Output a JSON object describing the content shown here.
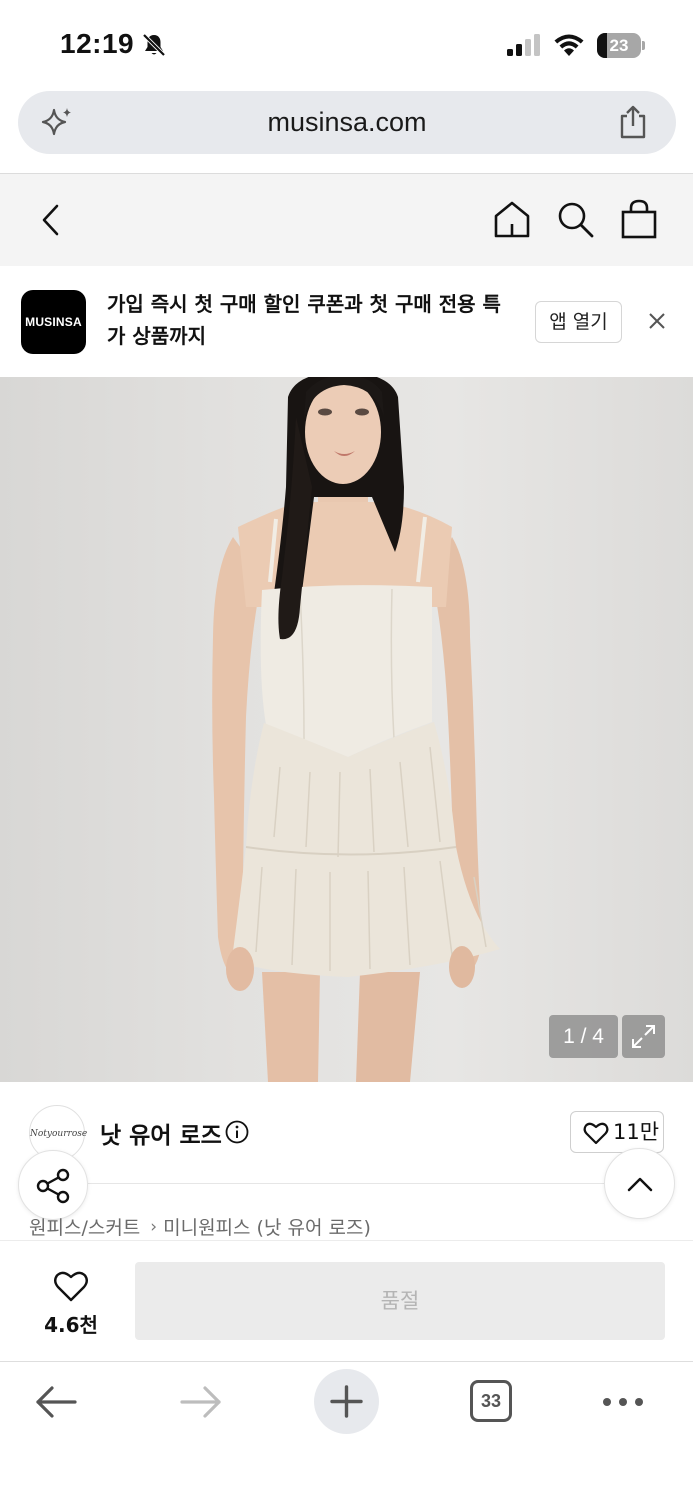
{
  "status_bar": {
    "time": "12:19",
    "battery": "23",
    "battery_level_percent": 23
  },
  "url_bar": {
    "url": "musinsa.com"
  },
  "app_banner": {
    "logo_text": "MUSINSA",
    "message": "가입 즉시 첫 구매 할인 쿠폰과 첫 구매 전용 특가 상품까지",
    "open_app_label": "앱 열기"
  },
  "gallery": {
    "counter": "1 / 4"
  },
  "brand": {
    "name": "낫 유어 로즈",
    "logo_script": "Notyourrose",
    "like_count": "11만"
  },
  "breadcrumb": {
    "category": "원피스/스커트",
    "separator": "›",
    "subcategory": "미니원피스 (낫 유어 로즈)"
  },
  "purchase": {
    "wish_count": "4.6천",
    "soldout_label": "품절"
  },
  "browser_toolbar": {
    "tab_count": "33"
  },
  "colors": {
    "accent": "#000000",
    "soldout_bg": "#ebebeb",
    "soldout_text": "#b4b4b4",
    "url_bar_bg": "#e7e9ed"
  },
  "icons": [
    "bell-slash-icon",
    "signal-icon",
    "wifi-icon",
    "sparkle-icon",
    "share-icon",
    "back-icon",
    "home-icon",
    "search-icon",
    "shopping-bag-icon",
    "close-icon",
    "expand-icon",
    "info-icon",
    "heart-icon",
    "share-nodes-icon",
    "chevron-up-icon",
    "arrow-left-icon",
    "arrow-right-icon",
    "plus-icon",
    "more-icon"
  ]
}
